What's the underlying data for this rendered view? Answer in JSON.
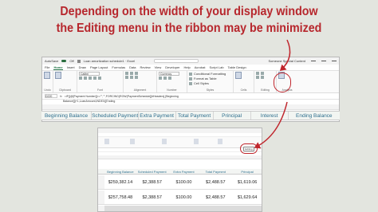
{
  "headline": {
    "line1": "Depending on the width of your display window",
    "line2": "the Editing menu in the ribbon may be minimized"
  },
  "excel_window": {
    "autosave_label": "AutoSave",
    "autosave_state": "Off",
    "file_name": "Loan amortization schedule1 · Excel",
    "user_name": "Someone Special Content",
    "menu_tabs": [
      "File",
      "Home",
      "Insert",
      "Draw",
      "Page Layout",
      "Formulas",
      "Data",
      "Review",
      "View",
      "Developer",
      "Help",
      "Acrobat",
      "Script Lab",
      "Table Design"
    ],
    "active_tab": "Home",
    "font_name": "Calibri",
    "number_format": "Currency",
    "ribbon_groups": [
      "Undo",
      "Clipboard",
      "Font",
      "Alignment",
      "Number",
      "Styles",
      "Cells",
      "Editing",
      "Analysis"
    ],
    "styles_items": [
      "Conditional Formatting",
      "Format as Table",
      "Cell Styles"
    ],
    "name_box": "D220",
    "formula_line1": "=IF([@[Payment Number]]<=\"\",\"\",FORCING(ROW(PaymentSchedule[[#Headers],[Beginning",
    "formula_line2": "Balance]])+1,LoanAmount,INDEX([Ending",
    "column_headers": [
      "Beginning Balance",
      "Scheduled Payment",
      "Extra Payment",
      "Total Payment",
      "Principal",
      "Interest",
      "Ending Balance"
    ],
    "highlight_color": "#c0262d"
  },
  "small_window": {
    "editing_label": "Editing",
    "column_headers": [
      "Beginning Balance",
      "Scheduled Payment",
      "Extra Payment",
      "Total Payment",
      "Principal"
    ],
    "rows": [
      {
        "values": [
          "$259,382.14",
          "$2,388.57",
          "$100.00",
          "$2,488.57",
          "$1,619.06"
        ]
      },
      {
        "values": [
          "$257,758.48",
          "$2,388.57",
          "$100.00",
          "$2,488.57",
          "$1,629.64"
        ]
      },
      {
        "values": [
          "",
          "",
          "",
          "",
          ""
        ]
      }
    ]
  }
}
